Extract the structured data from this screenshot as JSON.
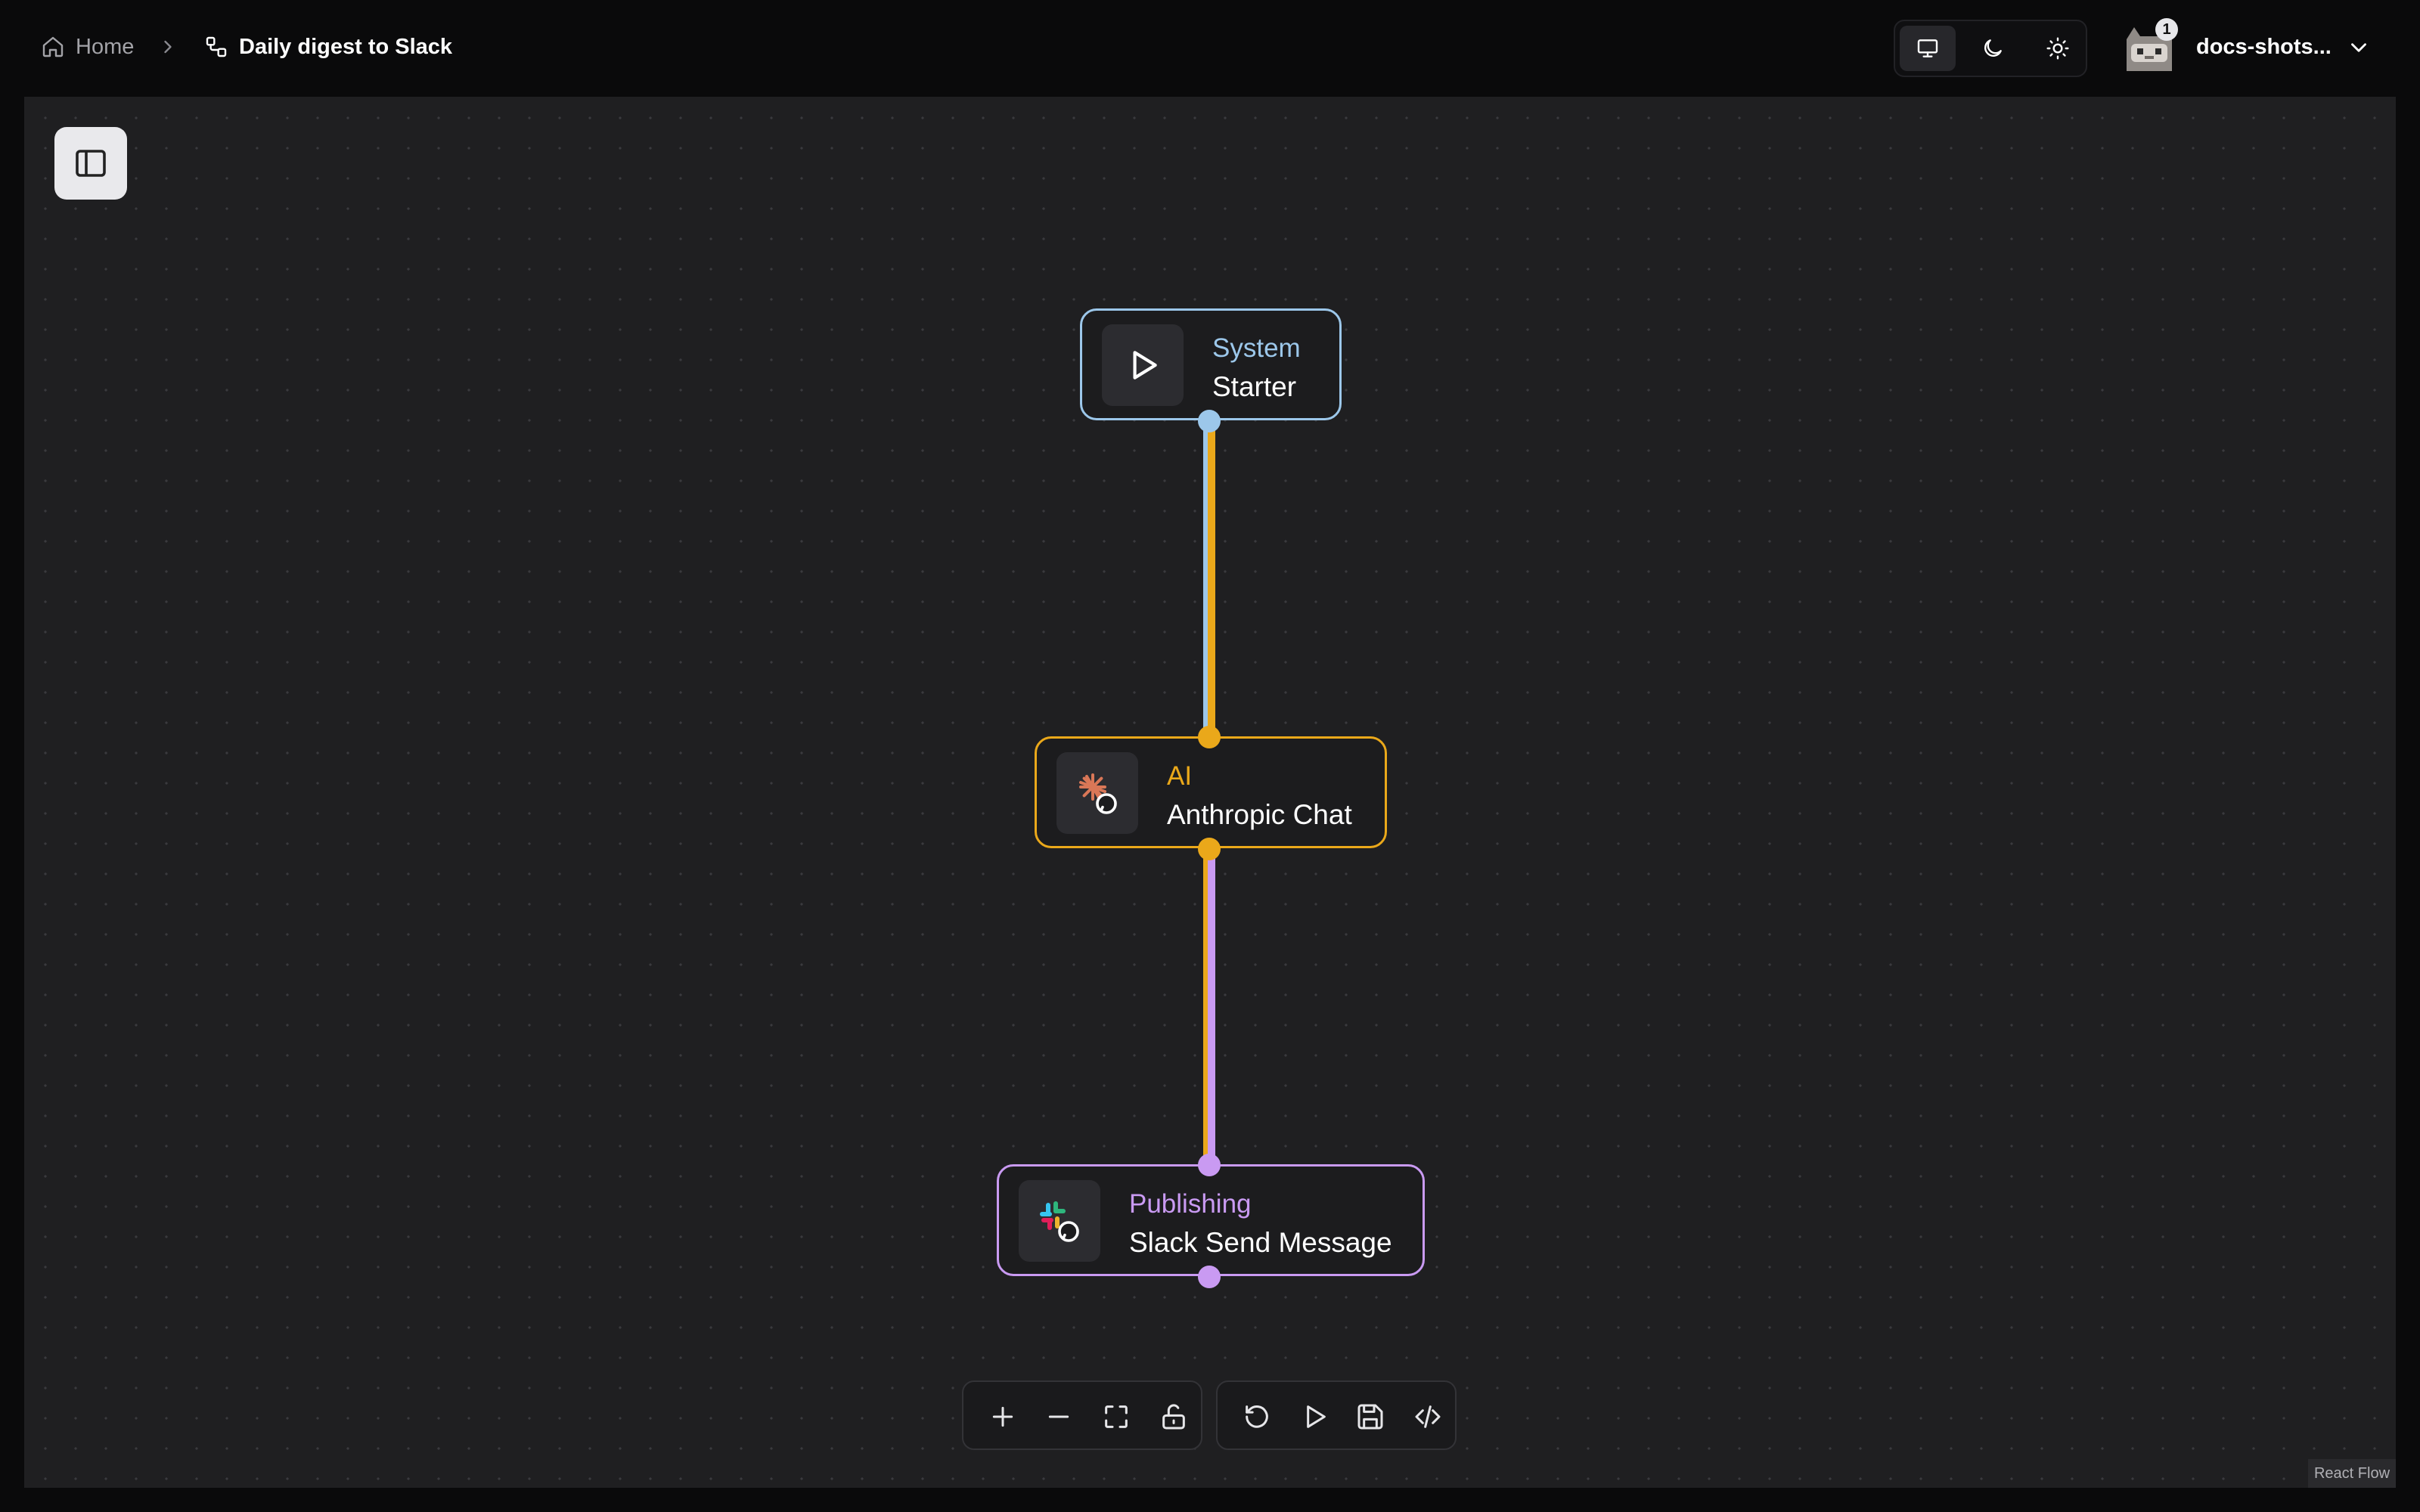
{
  "breadcrumb": {
    "home_label": "Home",
    "flow_label": "Daily digest to Slack"
  },
  "account": {
    "name": "docs-shots...",
    "notification_count": "1"
  },
  "theme_options": [
    "desktop-icon",
    "moon-icon",
    "sun-icon"
  ],
  "theme_active": "desktop-icon",
  "nodes": {
    "starter": {
      "category": "System",
      "title": "Starter",
      "color": "#9cc7ea"
    },
    "anthropic": {
      "category": "AI",
      "title": "Anthropic Chat",
      "color": "#eaa81a"
    },
    "slack": {
      "category": "Publishing",
      "title": "Slack Send Message",
      "color": "#c99af2"
    }
  },
  "edges": [
    {
      "from": "starter",
      "to": "anthropic"
    },
    {
      "from": "anthropic",
      "to": "slack"
    }
  ],
  "controls": {
    "left": [
      "plus-icon",
      "minus-icon",
      "fit-view-icon",
      "unlock-icon"
    ],
    "right": [
      "undo-icon",
      "play-icon",
      "save-icon",
      "code-icon"
    ]
  },
  "attribution": "React Flow"
}
